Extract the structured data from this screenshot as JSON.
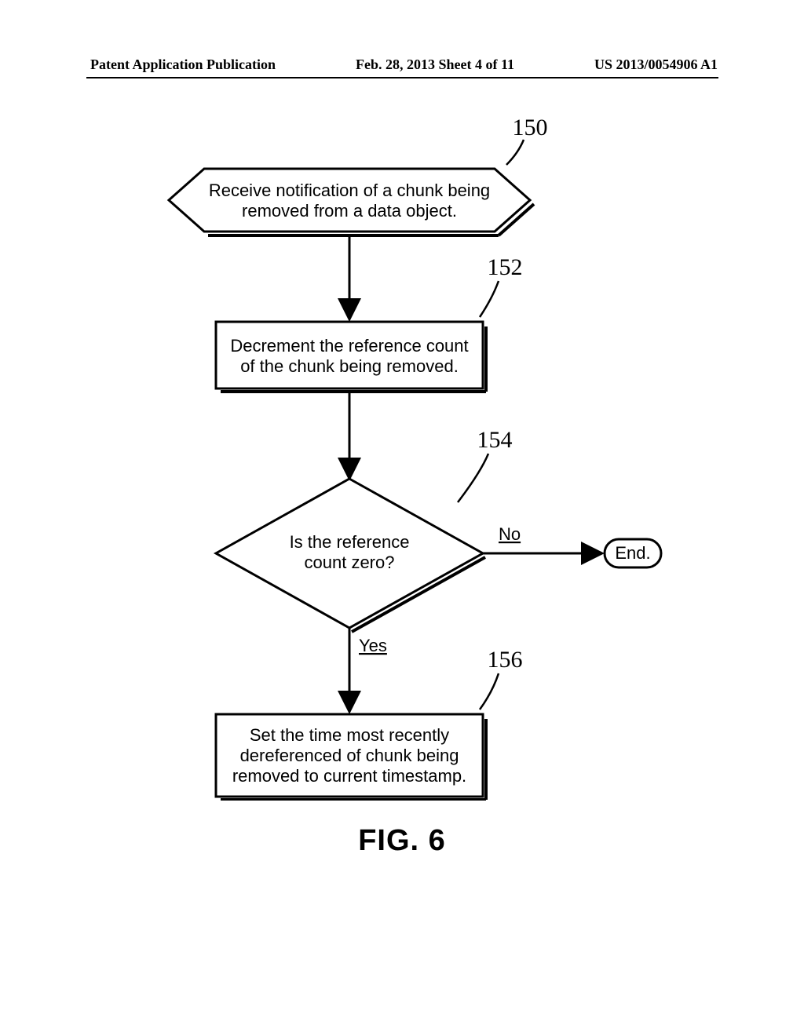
{
  "header": {
    "left": "Patent Application Publication",
    "center": "Feb. 28, 2013  Sheet 4 of 11",
    "right": "US 2013/0054906 A1"
  },
  "refs": {
    "r150": "150",
    "r152": "152",
    "r154": "154",
    "r156": "156"
  },
  "boxes": {
    "b150_l1": "Receive notification of a chunk being",
    "b150_l2": "removed from a data object.",
    "b152_l1": "Decrement the reference count",
    "b152_l2": "of the chunk being removed.",
    "b154_l1": "Is the reference",
    "b154_l2": "count zero?",
    "b156_l1": "Set the time most recently",
    "b156_l2": "dereferenced of chunk being",
    "b156_l3": "removed to current timestamp."
  },
  "edges": {
    "no": "No",
    "yes": "Yes",
    "end": "End."
  },
  "figure_label": "FIG. 6"
}
